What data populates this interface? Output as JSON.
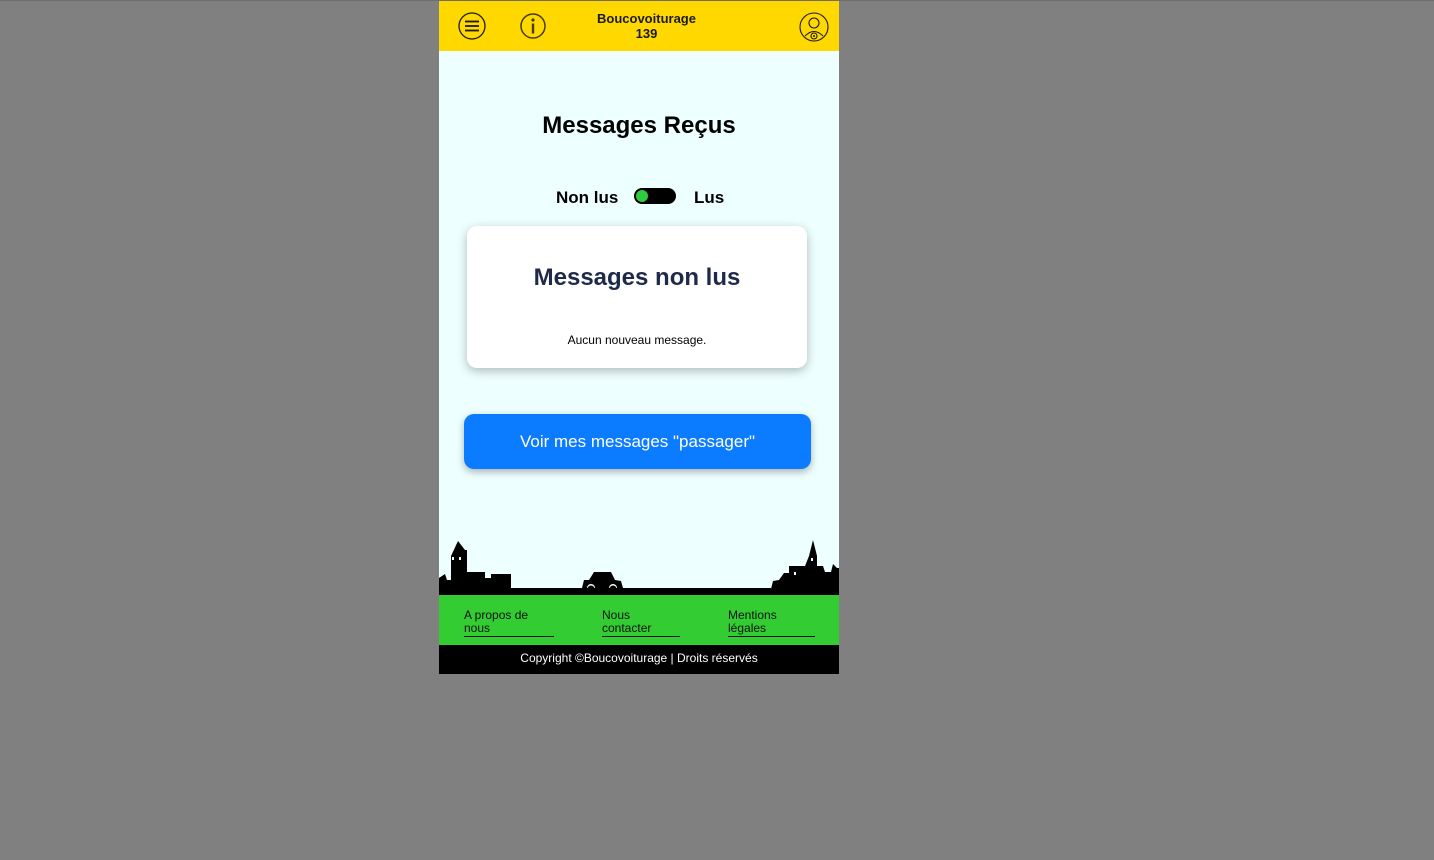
{
  "header": {
    "brand_name": "Boucovoiturage",
    "brand_count": "139",
    "background_color": "#ffd800"
  },
  "icons": {
    "menu": "hamburger-menu-icon",
    "info": "info-icon",
    "profile": "user-profile-icon"
  },
  "main": {
    "title": "Messages Reçus",
    "toggle": {
      "left_label": "Non lus",
      "right_label": "Lus",
      "state": "non lus",
      "knob_color": "#2ecc40"
    },
    "card": {
      "title": "Messages non lus",
      "empty_text": "Aucun nouveau message."
    },
    "cta_label": "Voir mes messages \"passager\"",
    "cta_color": "#0b7cff"
  },
  "footer": {
    "links": [
      {
        "label_line1": "A propos de",
        "label_line2": "nous"
      },
      {
        "label_line1": "Nous",
        "label_line2": "contacter"
      },
      {
        "label_line1": "Mentions",
        "label_line2": "légales"
      }
    ],
    "copyright": "Copyright ©Boucovoiturage | Droits réservés",
    "links_background": "#33cc33"
  }
}
